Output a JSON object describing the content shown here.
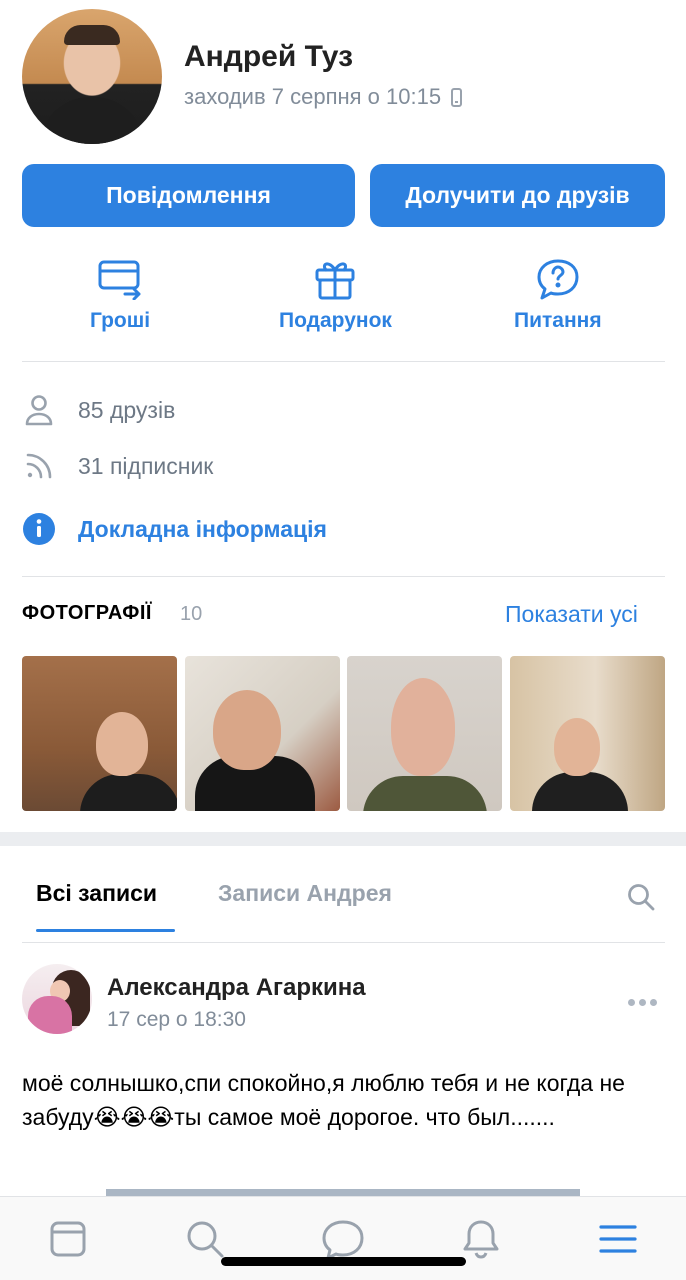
{
  "profile": {
    "name": "Андрей Туз",
    "last_seen": "заходив 7 серпня о 10:15"
  },
  "buttons": {
    "message": "Повідомлення",
    "add_friend": "Долучити до друзів"
  },
  "actions": {
    "money": "Гроші",
    "gift": "Подарунок",
    "question": "Питання"
  },
  "info": {
    "friends": "85 друзів",
    "followers": "31 підписник",
    "details": "Докладна інформація"
  },
  "photos": {
    "title": "ФОТОГРАФІЇ",
    "count": "10",
    "show_all": "Показати усі"
  },
  "wall": {
    "tab_all": "Всі записи",
    "tab_author": "Записи Андрея"
  },
  "post": {
    "author": "Александра Агаркина",
    "time": "17 сер о 18:30",
    "text": "моё солнышко,спи спокойно,я люблю тебя и не когда не забуду😭😭😭ты самое моё дорогое. что был......."
  },
  "colors": {
    "accent": "#2d81e0",
    "secondary_text": "#818c99",
    "divider": "#e1e3e6"
  },
  "icons": {
    "tabbar": [
      "newsfeed-icon",
      "search-icon",
      "messages-icon",
      "notifications-icon",
      "menu-icon"
    ]
  }
}
